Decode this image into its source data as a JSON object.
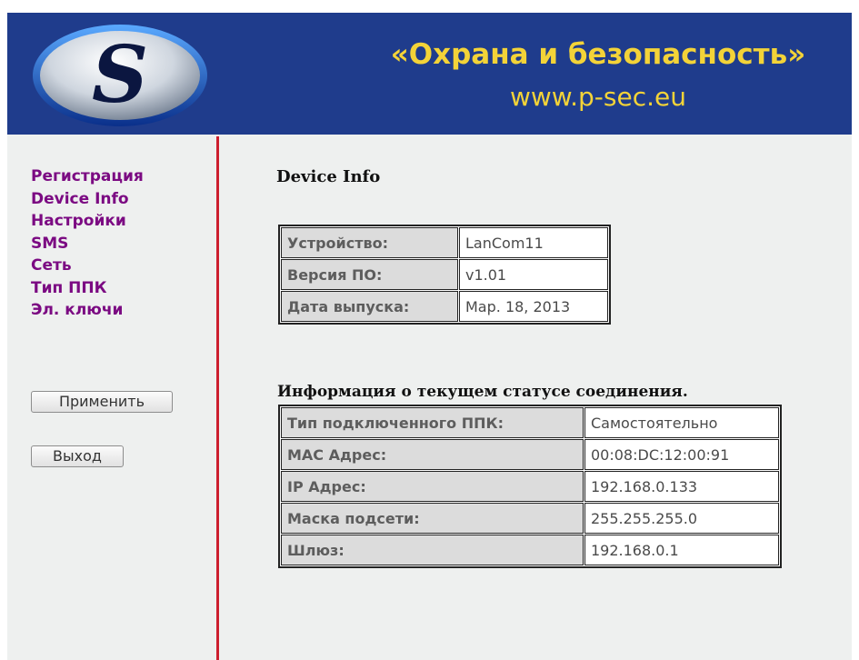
{
  "header": {
    "title": "«Охрана и безопасность»",
    "url": "www.p-sec.eu",
    "logo_letter": "S",
    "colors": {
      "background": "#1f3c8c",
      "text": "#f3d338"
    }
  },
  "sidebar": {
    "items": [
      {
        "label": "Регистрация"
      },
      {
        "label": "Device Info"
      },
      {
        "label": "Настройки"
      },
      {
        "label": "SMS"
      },
      {
        "label": "Сеть"
      },
      {
        "label": "Тип ППК"
      },
      {
        "label": "Эл. ключи"
      }
    ],
    "apply_button": "Применить",
    "exit_button": "Выход",
    "link_color": "#7b0a82"
  },
  "main": {
    "device_title": "Device Info",
    "device_rows": [
      {
        "label": "Устройство:",
        "value": "LanCom11"
      },
      {
        "label": "Версия ПО:",
        "value": "v1.01"
      },
      {
        "label": "Дата выпуска:",
        "value": "Мар. 18, 2013"
      }
    ],
    "connection_title": "Информация о текущем статусе соединения.",
    "connection_rows": [
      {
        "label": "Тип подключенного ППК:",
        "value": "Самостоятельно"
      },
      {
        "label": "MAC Адрес:",
        "value": "00:08:DC:12:00:91"
      },
      {
        "label": "IP Адрес:",
        "value": "192.168.0.133"
      },
      {
        "label": "Маска подсети:",
        "value": "255.255.255.0"
      },
      {
        "label": "Шлюз:",
        "value": "192.168.0.1"
      }
    ]
  }
}
